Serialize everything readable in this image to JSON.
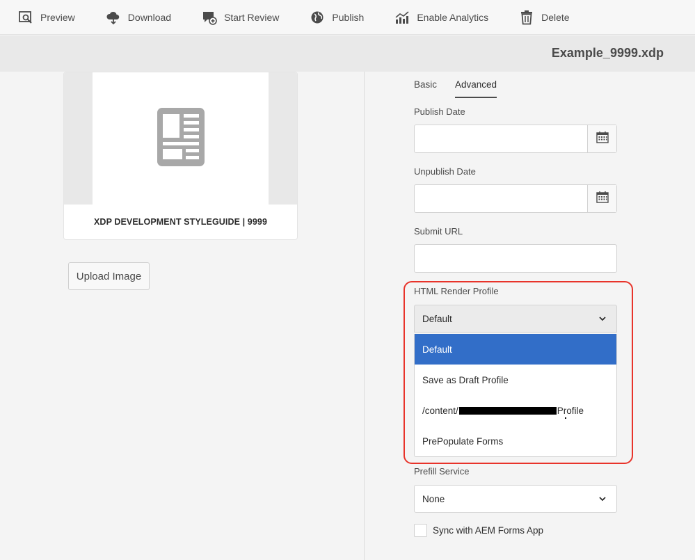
{
  "toolbar": {
    "items": [
      {
        "label": "Preview",
        "icon": "preview-icon"
      },
      {
        "label": "Download",
        "icon": "cloud-download-icon"
      },
      {
        "label": "Start Review",
        "icon": "review-icon"
      },
      {
        "label": "Publish",
        "icon": "globe-icon"
      },
      {
        "label": "Enable Analytics",
        "icon": "analytics-icon"
      },
      {
        "label": "Delete",
        "icon": "trash-icon"
      }
    ]
  },
  "header": {
    "file_title": "Example_9999.xdp"
  },
  "card": {
    "label": "XDP DEVELOPMENT STYLEGUIDE | 9999",
    "thumbnail_icon": "document-layout-icon"
  },
  "upload_button": "Upload Image",
  "tabs": [
    {
      "label": "Basic",
      "active": false
    },
    {
      "label": "Advanced",
      "active": true
    }
  ],
  "fields": {
    "publish_date": {
      "label": "Publish Date",
      "value": ""
    },
    "unpublish_date": {
      "label": "Unpublish Date",
      "value": ""
    },
    "submit_url": {
      "label": "Submit URL",
      "value": ""
    }
  },
  "render_profile": {
    "label": "HTML Render Profile",
    "selected": "Default",
    "options": [
      "Default",
      "Save as Draft Profile",
      "/content/",
      "Profile",
      "PrePopulate Forms"
    ]
  },
  "prefill_service": {
    "label": "Prefill Service",
    "selected": "None"
  },
  "sync_checkbox": {
    "label": "Sync with AEM Forms App",
    "checked": false
  },
  "colors": {
    "accent": "#326ec8",
    "highlight": "#e8332a"
  }
}
